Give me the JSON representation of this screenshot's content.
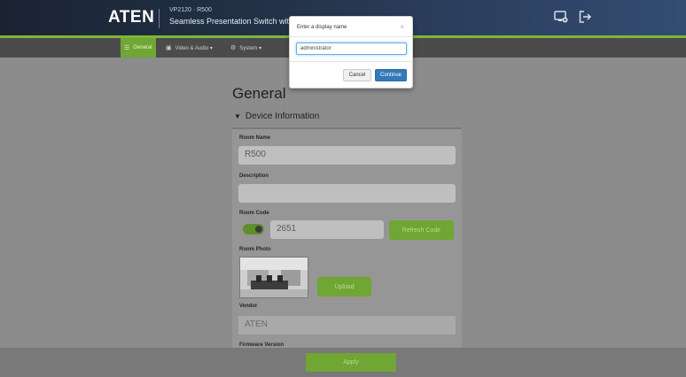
{
  "header": {
    "logo": "ATEN",
    "model": "VP2120 · R500",
    "product": "Seamless Presentation Switch with",
    "icons": [
      "monitor-settings-icon",
      "logout-icon"
    ]
  },
  "nav": {
    "items": [
      {
        "icon": "list-icon",
        "label": "General"
      },
      {
        "icon": "video-audio-icon",
        "label": "Video & Audio ▾"
      },
      {
        "icon": "gear-icon",
        "label": "System ▾"
      }
    ]
  },
  "page": {
    "title": "General",
    "section": "Device Information",
    "fields": {
      "room_name_label": "Room Name",
      "room_name_value": "R500",
      "description_label": "Description",
      "description_value": "",
      "room_code_label": "Room Code",
      "room_code_value": "2651",
      "refresh_code_label": "Refresh Code",
      "room_photo_label": "Room Photo",
      "upload_label": "Upload",
      "vendor_label": "Vendor",
      "vendor_value": "ATEN",
      "firmware_label": "Firmware Version"
    }
  },
  "bottombar": {
    "apply_label": "Apply"
  },
  "modal": {
    "title": "Enter a display name",
    "close": "×",
    "input_value": "administrator",
    "cancel_label": "Cancel",
    "continue_label": "Continue"
  },
  "colors": {
    "accent_green": "#6fa634",
    "primary_blue": "#337ab7",
    "header_navy": "#233248"
  }
}
